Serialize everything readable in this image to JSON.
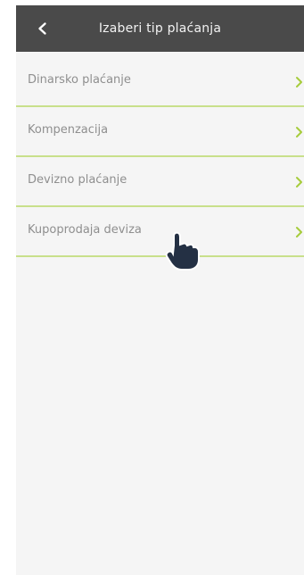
{
  "header": {
    "title": "Izaberi tip plaćanja",
    "back_icon": "chevron-left-icon"
  },
  "payment_types": [
    {
      "label": "Dinarsko plaćanje",
      "icon": "chevron-right-icon"
    },
    {
      "label": "Kompenzacija",
      "icon": "chevron-right-icon"
    },
    {
      "label": "Devizno plaćanje",
      "icon": "chevron-right-icon"
    },
    {
      "label": "Kupoprodaja deviza",
      "icon": "chevron-right-icon"
    }
  ],
  "pointer": {
    "icon": "hand-pointer-icon"
  },
  "colors": {
    "header_bg": "#4a4a4a",
    "list_bg": "#f5f5f5",
    "accent": "#a6cc3c",
    "divider": "#c8e08b",
    "text": "#8f8f8f"
  }
}
